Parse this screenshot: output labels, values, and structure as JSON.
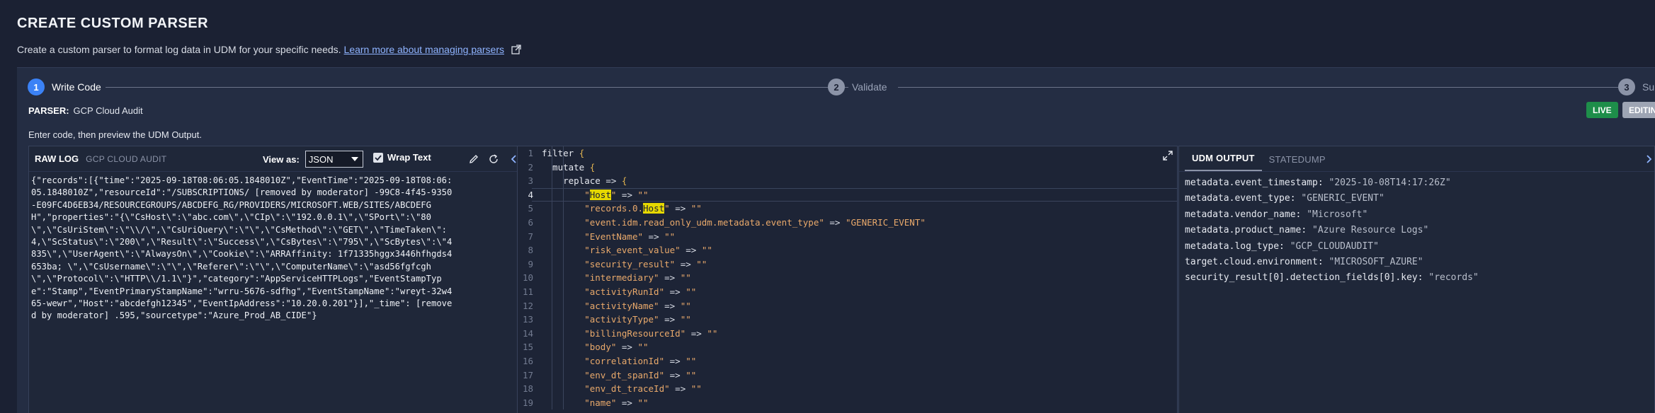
{
  "page": {
    "title": "CREATE CUSTOM PARSER",
    "subtitle": "Create a custom parser to format log data in UDM for your specific needs.",
    "learn_link": "Learn more about managing parsers"
  },
  "stepper": {
    "steps": [
      {
        "num": "1",
        "label": "Write Code",
        "state": "active"
      },
      {
        "num": "2",
        "label": "Validate",
        "state": "inactive"
      },
      {
        "num": "3",
        "label": "Sub",
        "state": "inactive"
      }
    ]
  },
  "parser": {
    "key": "PARSER:",
    "name": "GCP Cloud Audit"
  },
  "badges": {
    "live": "LIVE",
    "editing": "EDITIN"
  },
  "instruction": "Enter code, then preview the UDM Output.",
  "raw_log": {
    "title": "RAW LOG",
    "source": "GCP CLOUD AUDIT",
    "view_as_label": "View as:",
    "view_as_value": "JSON",
    "wrap_text_label": "Wrap Text",
    "lines": [
      "{\"records\":[{\"time\":\"2025-09-18T08:06:05.1848010Z\",\"EventTime\":\"2025-09-18T08:06:",
      "05.1848010Z\",\"resourceId\":\"/SUBSCRIPTIONS/ [removed by moderator] -99C8-4f45-9350",
      "-E09FC4D6EB34/RESOURCEGROUPS/ABCDEFG_RG/PROVIDERS/MICROSOFT.WEB/SITES/ABCDEFG",
      "H\",\"properties\":\"{\\\"CsHost\\\":\\\"abc.com\\\",\\\"CIp\\\":\\\"192.0.0.1\\\",\\\"SPort\\\":\\\"80",
      "\\\",\\\"CsUriStem\\\":\\\"\\\\/\\\",\\\"CsUriQuery\\\":\\\"\\\",\\\"CsMethod\\\":\\\"GET\\\",\\\"TimeTaken\\\":",
      "4,\\\"ScStatus\\\":\\\"200\\\",\\\"Result\\\":\\\"Success\\\",\\\"CsBytes\\\":\\\"795\\\",\\\"ScBytes\\\":\\\"4",
      "835\\\",\\\"UserAgent\\\":\\\"AlwaysOn\\\",\\\"Cookie\\\":\\\"ARRAffinity: 1f71335hggx3446hfhgds4",
      "653ba; \\\",\\\"CsUsername\\\":\\\"\\\",\\\"Referer\\\":\\\"\\\",\\\"ComputerName\\\":\\\"asd56fgfcgh",
      "\\\",\\\"Protocol\\\":\\\"HTTP\\\\/1.1\\\"}\",\"category\":\"AppServiceHTTPLogs\",\"EventStampTyp",
      "e\":\"Stamp\",\"EventPrimaryStampName\":\"wrru-5676-sdfhg\",\"EventStampName\":\"wreyt-32w4",
      "65-wewr\",\"Host\":\"abcdefgh12345\",\"EventIpAddress\":\"10.20.0.201\"}],\"_time\": [remove",
      "d by moderator] .595,\"sourcetype\":\"Azure_Prod_AB_CIDE\"}"
    ]
  },
  "code_editor": {
    "lines": [
      {
        "n": "1",
        "text": "filter {"
      },
      {
        "n": "2",
        "text": "  mutate {"
      },
      {
        "n": "3",
        "text": "    replace => {"
      },
      {
        "n": "4",
        "text": "        \"Host\" => \"\""
      },
      {
        "n": "5",
        "text": "        \"records.0.Host\" => \"\""
      },
      {
        "n": "6",
        "text": "        \"event.idm.read_only_udm.metadata.event_type\" => \"GENERIC_EVENT\""
      },
      {
        "n": "7",
        "text": "        \"EventName\" => \"\""
      },
      {
        "n": "8",
        "text": "        \"risk_event_value\" => \"\""
      },
      {
        "n": "9",
        "text": "        \"security_result\" => \"\""
      },
      {
        "n": "10",
        "text": "        \"intermediary\" => \"\""
      },
      {
        "n": "11",
        "text": "        \"activityRunId\" => \"\""
      },
      {
        "n": "12",
        "text": "        \"activityName\" => \"\""
      },
      {
        "n": "13",
        "text": "        \"activityType\" => \"\""
      },
      {
        "n": "14",
        "text": "        \"billingResourceId\" => \"\""
      },
      {
        "n": "15",
        "text": "        \"body\" => \"\""
      },
      {
        "n": "16",
        "text": "        \"correlationId\" => \"\""
      },
      {
        "n": "17",
        "text": "        \"env_dt_spanId\" => \"\""
      },
      {
        "n": "18",
        "text": "        \"env_dt_traceId\" => \"\""
      },
      {
        "n": "19",
        "text": "        \"name\" => \"\""
      }
    ]
  },
  "udm_output": {
    "tabs": [
      "UDM OUTPUT",
      "STATEDUMP"
    ],
    "fields": [
      {
        "key": "metadata.event_timestamp:",
        "value": "\"2025-10-08T14:17:26Z\""
      },
      {
        "key": "metadata.event_type:",
        "value": "\"GENERIC_EVENT\""
      },
      {
        "key": "metadata.vendor_name:",
        "value": "\"Microsoft\""
      },
      {
        "key": "metadata.product_name:",
        "value": "\"Azure Resource Logs\""
      },
      {
        "key": "metadata.log_type:",
        "value": "\"GCP_CLOUDAUDIT\""
      },
      {
        "key": "target.cloud.environment:",
        "value": "\"MICROSOFT_AZURE\""
      },
      {
        "key": "security_result[0].detection_fields[0].key:",
        "value": "\"records\""
      }
    ]
  },
  "colors": {
    "accent": "#3b82f6",
    "live": "#1e8e4a",
    "highlight": "#e6d800",
    "string": "#e9a96b"
  }
}
